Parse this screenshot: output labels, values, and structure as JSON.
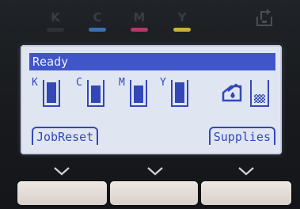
{
  "indicators": {
    "inks": [
      {
        "letter": "K",
        "color": "#2e3136",
        "letter_color": "#3a3d42"
      },
      {
        "letter": "C",
        "color": "#3a6fb0",
        "letter_color": "#3a3d42"
      },
      {
        "letter": "M",
        "color": "#b23a6a",
        "letter_color": "#3a3d42"
      },
      {
        "letter": "Y",
        "color": "#c9b23a",
        "letter_color": "#3a3d42"
      }
    ],
    "tray_icon": "paper-tray-icon"
  },
  "lcd": {
    "status": "Ready",
    "cartridges": [
      {
        "label": "K",
        "level": 0.8
      },
      {
        "label": "C",
        "level": 0.8
      },
      {
        "label": "M",
        "level": 0.7
      },
      {
        "label": "Y",
        "level": 0.8
      }
    ],
    "maintenance_icon": "maintenance-box-icon",
    "maintenance_level": 0.35,
    "softkeys": {
      "left": "JobReset",
      "right": "Supplies"
    }
  },
  "buttons": {
    "chevron_icon": "chevron-down-icon"
  }
}
